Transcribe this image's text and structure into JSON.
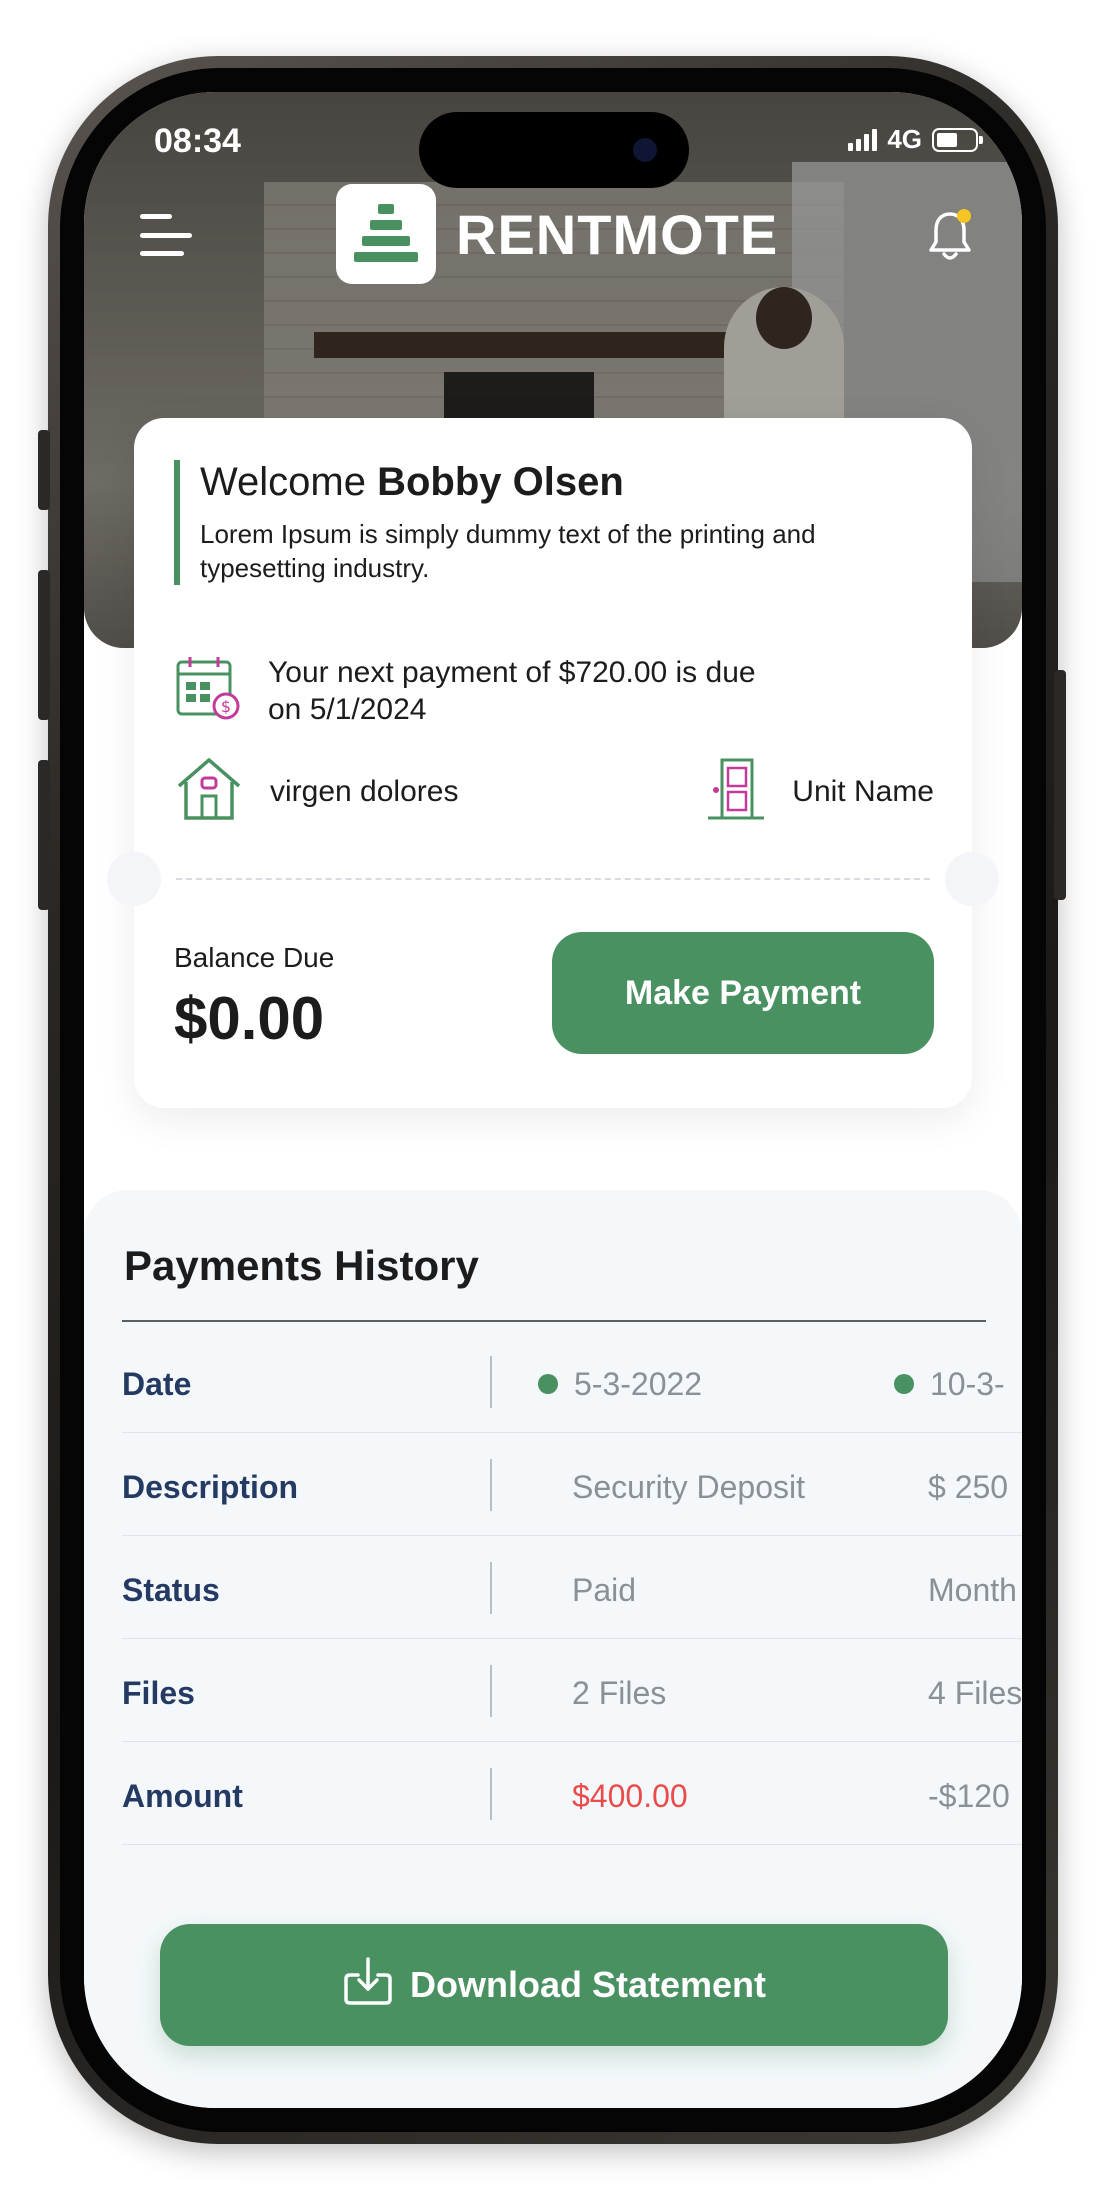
{
  "status_bar": {
    "time": "08:34",
    "network": "4G"
  },
  "header": {
    "brand": "RENTMOTE",
    "menu_icon": "hamburger-menu-icon",
    "notification_icon": "bell-icon"
  },
  "welcome": {
    "greeting": "Welcome ",
    "name": "Bobby Olsen",
    "description": "Lorem Ipsum is simply dummy text of the printing and typesetting industry."
  },
  "next_payment": {
    "text": "Your next payment of $720.00 is due on 5/1/2024",
    "icon": "calendar-payment-icon"
  },
  "property": {
    "name": "virgen dolores",
    "unit": "Unit Name",
    "property_icon": "house-icon",
    "unit_icon": "door-icon"
  },
  "balance": {
    "label": "Balance Due",
    "value": "$0.00",
    "action_label": "Make Payment"
  },
  "payments_history": {
    "title": "Payments History",
    "rows": [
      {
        "label": "Date",
        "values": [
          "5-3-2022",
          "10-3-"
        ]
      },
      {
        "label": "Description",
        "values": [
          "Security Deposit",
          "$ 250"
        ]
      },
      {
        "label": "Status",
        "values": [
          "Paid",
          "Month"
        ]
      },
      {
        "label": "Files",
        "values": [
          "2 Files",
          "4 Files"
        ]
      },
      {
        "label": "Amount",
        "values": [
          "$400.00",
          "-$120"
        ]
      }
    ]
  },
  "download": {
    "label": "Download Statement",
    "icon": "download-icon"
  },
  "colors": {
    "brand_green": "#4a9162",
    "label_navy": "#253a63",
    "negative_red": "#ea4b4b",
    "notification_dot": "#f3c623"
  }
}
